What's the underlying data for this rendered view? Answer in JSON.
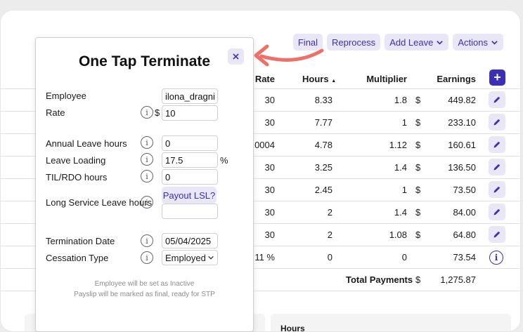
{
  "toolbar": {
    "final": "Final",
    "reprocess": "Reprocess",
    "add_leave": "Add Leave",
    "actions": "Actions"
  },
  "table": {
    "headers": {
      "rate": "Rate",
      "hours": "Hours",
      "hours_sort": "▲",
      "multiplier": "Multiplier",
      "earnings": "Earnings"
    },
    "rows": [
      {
        "rate": "30",
        "hours": "8.33",
        "multiplier": "1.8",
        "dollar": "$",
        "earnings": "449.82"
      },
      {
        "rate": "30",
        "hours": "7.77",
        "multiplier": "1",
        "dollar": "$",
        "earnings": "233.10"
      },
      {
        "rate": ".0004",
        "hours": "4.78",
        "multiplier": "1.12",
        "dollar": "$",
        "earnings": "160.61"
      },
      {
        "rate": "30",
        "hours": "3.25",
        "multiplier": "1.4",
        "dollar": "$",
        "earnings": "136.50"
      },
      {
        "rate": "30",
        "hours": "2.45",
        "multiplier": "1",
        "dollar": "$",
        "earnings": "73.50"
      },
      {
        "rate": "30",
        "hours": "2",
        "multiplier": "1.4",
        "dollar": "$",
        "earnings": "84.00"
      },
      {
        "rate": "30",
        "hours": "2",
        "multiplier": "1.08",
        "dollar": "$",
        "earnings": "64.80"
      },
      {
        "rate": "11 %",
        "hours": "0",
        "multiplier": "0",
        "dollar": "",
        "earnings": "73.54"
      }
    ],
    "total_label": "Total Payments",
    "total_dollar": "$",
    "total_value": "1,275.87"
  },
  "bottom": {
    "hours_header": "Hours"
  },
  "modal": {
    "title": "One Tap Terminate",
    "employee_label": "Employee",
    "employee_value": "ilona_dragni",
    "rate_label": "Rate",
    "rate_unit": "$",
    "rate_value": "10",
    "annual_leave_label": "Annual Leave hours",
    "annual_leave_value": "0",
    "leave_loading_label": "Leave Loading",
    "leave_loading_value": "17.5",
    "leave_loading_unit": "%",
    "til_label": "TIL/RDO hours",
    "til_value": "0",
    "lsl_label": "Long Service Leave hours",
    "payout_lsl": "Payout LSL?",
    "lsl_value": "",
    "termination_label": "Termination Date",
    "termination_value": "05/04/2025",
    "cessation_label": "Cessation Type",
    "cessation_value": "Employed",
    "note_1": "Employee will be set as Inactive",
    "note_2": "Payslip will be marked as final, ready for STP"
  },
  "colors": {
    "accent": "#3b2fb5",
    "accent_soft": "#e9e7f7",
    "annotation_arrow": "#f07068"
  }
}
